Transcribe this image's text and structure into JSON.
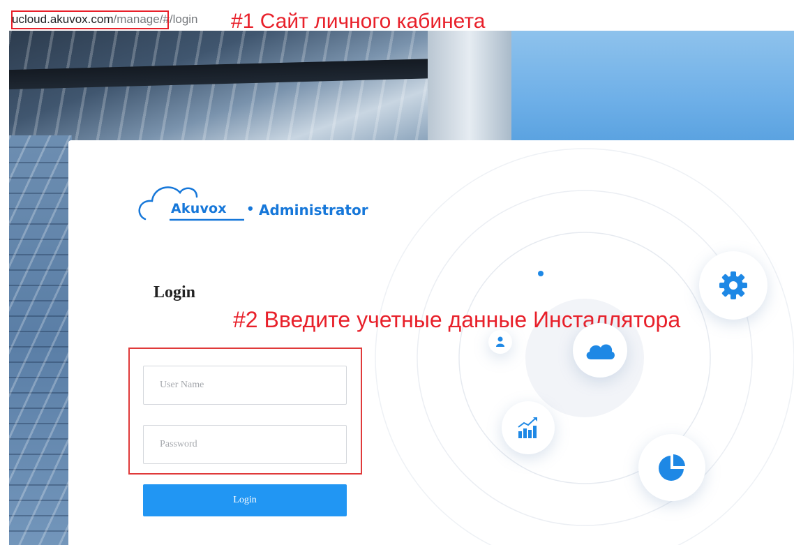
{
  "browser": {
    "url_host": "ucloud.akuvox.com",
    "url_path": "/manage/#/login"
  },
  "annotations": {
    "step1": "#1 Сайт личного кабинета",
    "step2": "#2 Введите учетные данные Инсталлятора"
  },
  "brand": {
    "logo_word": "Akuvox",
    "separator": "•",
    "subtitle": "Administrator"
  },
  "login": {
    "title": "Login",
    "username_placeholder": "User Name",
    "password_placeholder": "Password",
    "button_label": "Login"
  },
  "icons": [
    "cloud-icon",
    "gear-icon",
    "user-icon",
    "chart-icon",
    "pie-chart-icon"
  ],
  "colors": {
    "accent": "#2196f3",
    "brand": "#1677d9",
    "annotation": "#e8202a"
  }
}
